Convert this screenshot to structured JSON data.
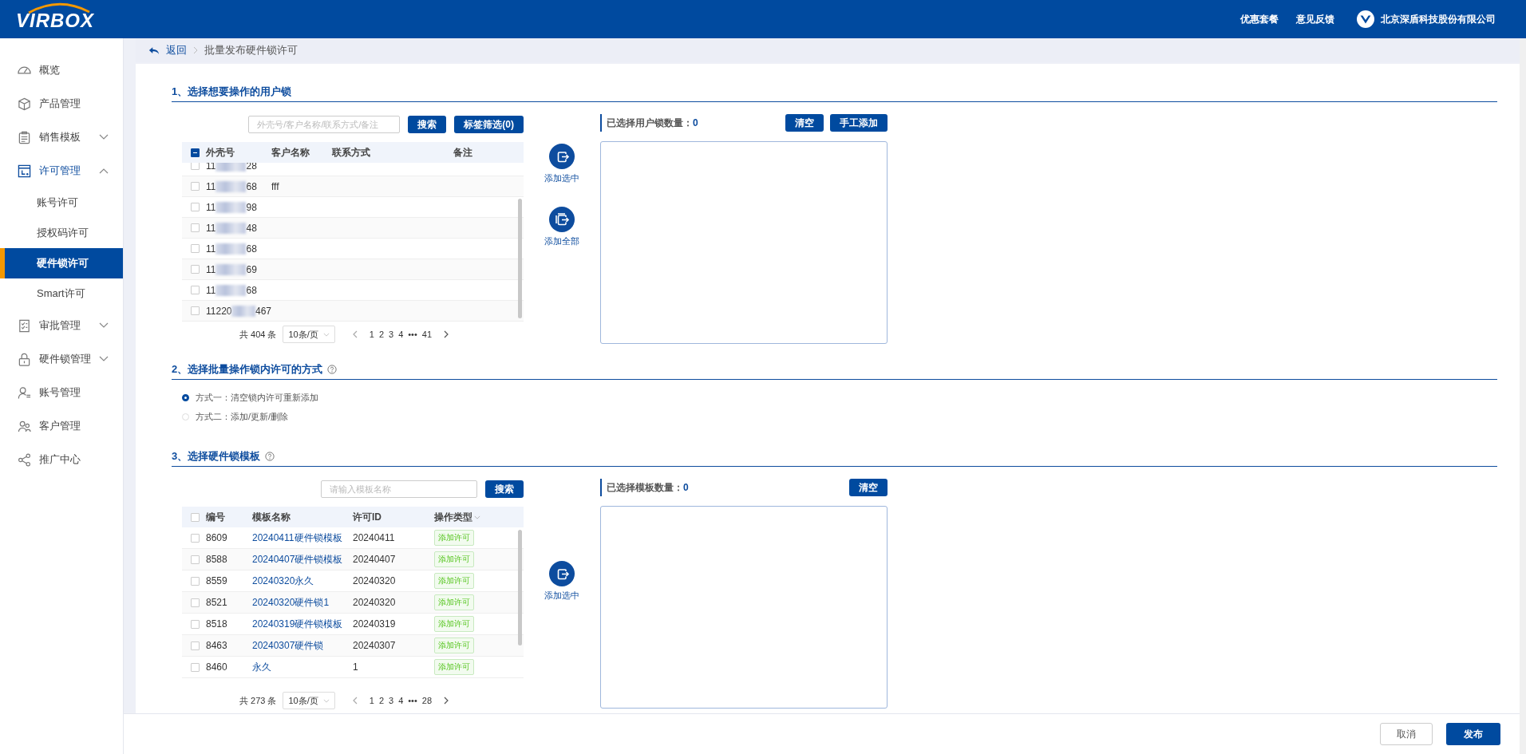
{
  "header": {
    "logo": "VIRBOX",
    "links": [
      "优惠套餐",
      "意见反馈"
    ],
    "company": "北京深盾科技股份有限公司"
  },
  "sidebar": {
    "items": [
      {
        "label": "概览",
        "kind": "gauge"
      },
      {
        "label": "产品管理",
        "kind": "cube"
      },
      {
        "label": "销售模板",
        "kind": "clipboard",
        "expanded": false
      },
      {
        "label": "许可管理",
        "kind": "license",
        "expanded": true,
        "children": [
          {
            "label": "账号许可",
            "selected": false
          },
          {
            "label": "授权码许可",
            "selected": false
          },
          {
            "label": "硬件锁许可",
            "selected": true
          },
          {
            "label": "Smart许可",
            "selected": false
          }
        ]
      },
      {
        "label": "审批管理",
        "kind": "approval",
        "expanded": false
      },
      {
        "label": "硬件锁管理",
        "kind": "lock",
        "expanded": false
      },
      {
        "label": "账号管理",
        "kind": "user"
      },
      {
        "label": "客户管理",
        "kind": "users"
      },
      {
        "label": "推广中心",
        "kind": "share"
      }
    ]
  },
  "breadcrumb": {
    "back": "返回",
    "current": "批量发布硬件锁许可"
  },
  "section1": {
    "title": "1、选择想要操作的用户锁",
    "search": {
      "placeholder": "外壳号/客户名称/联系方式/备注"
    },
    "buttons": [
      "搜索",
      "标签筛选(0)"
    ],
    "table": {
      "indeterminate": true,
      "columns": [
        "外壳号",
        "客户名称",
        "联系方式",
        "备注"
      ],
      "rows": [
        {
          "checked": false,
          "serial_start": "11",
          "serial_end": "28"
        },
        {
          "checked": false,
          "serial_start": "11",
          "serial_end": "68",
          "customer": "fff"
        },
        {
          "checked": false,
          "serial_start": "11",
          "serial_end": "98"
        },
        {
          "checked": false,
          "serial_start": "11",
          "serial_end": "48"
        },
        {
          "checked": false,
          "serial_start": "11",
          "serial_end": "68"
        },
        {
          "checked": false,
          "serial_start": "11",
          "serial_end": "69"
        },
        {
          "checked": false,
          "serial_start": "11",
          "serial_end": "68"
        },
        {
          "checked": false,
          "serial_start": "11220",
          "serial_end": "467"
        }
      ]
    },
    "pagination": {
      "total": "共 404 条",
      "page_size": "10条/页",
      "pages": [
        "1",
        "2",
        "3",
        "4",
        "•••",
        "41"
      ]
    },
    "transfer": [
      {
        "kind": "selected",
        "label": "添加选中"
      },
      {
        "kind": "all",
        "label": "添加全部"
      }
    ],
    "picked": {
      "label": "已选择用户锁数量：",
      "count": "0",
      "buttons": [
        "清空",
        "手工添加"
      ]
    }
  },
  "section2": {
    "title": "2、选择批量操作锁内许可的方式",
    "options": [
      {
        "label": "方式一：清空锁内许可重新添加",
        "selected": true
      },
      {
        "label": "方式二：添加/更新/删除",
        "selected": false
      }
    ]
  },
  "section3": {
    "title": "3、选择硬件锁模板",
    "search": {
      "placeholder": "请输入模板名称"
    },
    "buttons": [
      "搜索"
    ],
    "table": {
      "indeterminate": false,
      "columns": [
        "编号",
        "模板名称",
        "许可ID",
        "操作类型"
      ],
      "rows": [
        {
          "checked": false,
          "id": "8609",
          "name": "20240411硬件锁模板",
          "license_id": "20240411",
          "op": "添加许可"
        },
        {
          "checked": false,
          "id": "8588",
          "name": "20240407硬件锁模板",
          "license_id": "20240407",
          "op": "添加许可"
        },
        {
          "checked": false,
          "id": "8559",
          "name": "20240320永久",
          "license_id": "20240320",
          "op": "添加许可"
        },
        {
          "checked": false,
          "id": "8521",
          "name": "20240320硬件锁1",
          "license_id": "20240320",
          "op": "添加许可"
        },
        {
          "checked": false,
          "id": "8518",
          "name": "20240319硬件锁模板",
          "license_id": "20240319",
          "op": "添加许可"
        },
        {
          "checked": false,
          "id": "8463",
          "name": "20240307硬件锁",
          "license_id": "20240307",
          "op": "添加许可"
        },
        {
          "checked": false,
          "id": "8460",
          "name": "永久",
          "license_id": "1",
          "op": "添加许可"
        }
      ]
    },
    "pagination": {
      "total": "共 273 条",
      "page_size": "10条/页",
      "pages": [
        "1",
        "2",
        "3",
        "4",
        "•••",
        "28"
      ]
    },
    "transfer": [
      {
        "kind": "selected",
        "label": "添加选中"
      }
    ],
    "picked": {
      "label": "已选择模板数量：",
      "count": "0",
      "buttons": [
        "清空"
      ]
    }
  },
  "footer": {
    "cancel": "取消",
    "publish": "发布"
  }
}
